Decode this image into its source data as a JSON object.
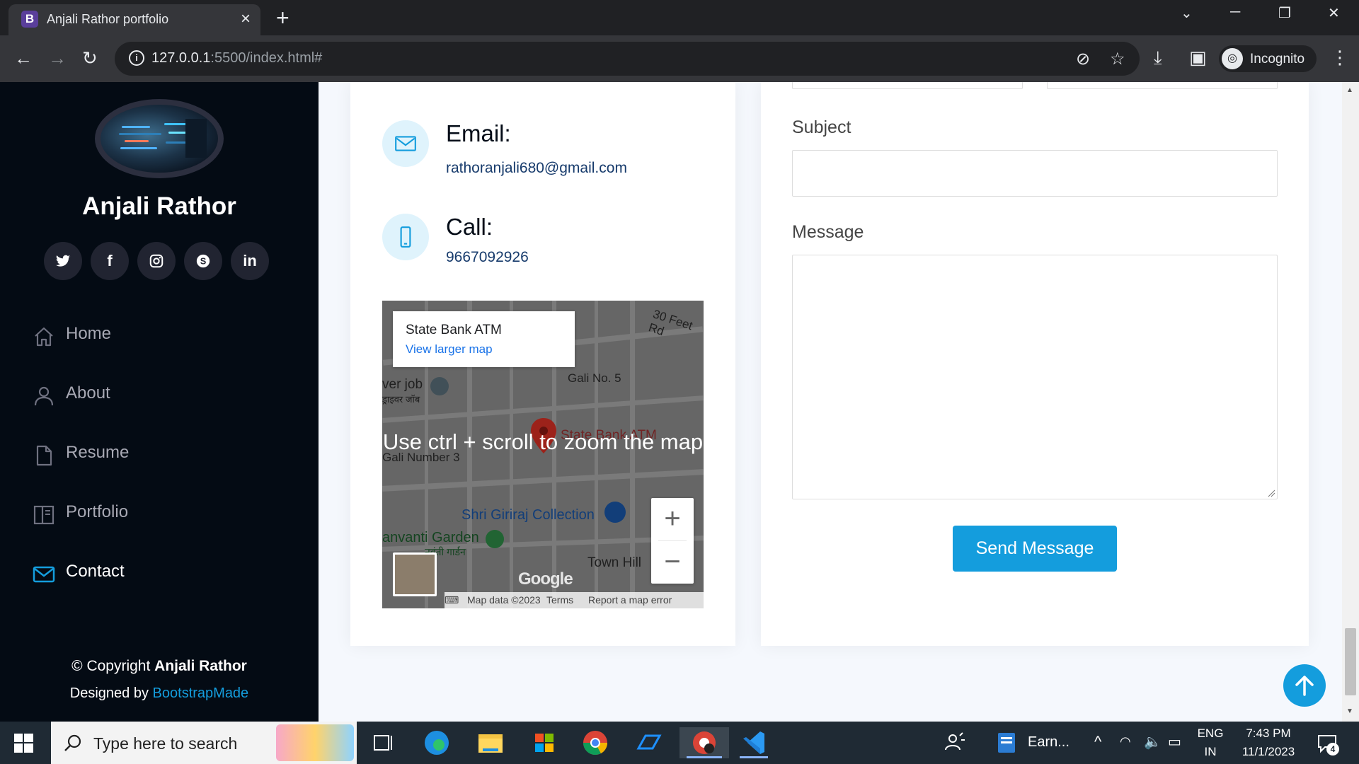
{
  "browser": {
    "tab_favicon": "B",
    "tab_title": "Anjali Rathor portfolio",
    "url_host": "127.0.0.1",
    "url_rest": ":5500/index.html#",
    "incognito_label": "Incognito"
  },
  "sidebar": {
    "name": "Anjali Rathor",
    "social": [
      "twitter-icon",
      "facebook-icon",
      "instagram-icon",
      "skype-icon",
      "linkedin-icon"
    ],
    "nav": [
      {
        "label": "Home",
        "icon": "home-icon",
        "active": false
      },
      {
        "label": "About",
        "icon": "person-icon",
        "active": false
      },
      {
        "label": "Resume",
        "icon": "file-icon",
        "active": false
      },
      {
        "label": "Portfolio",
        "icon": "book-icon",
        "active": false
      },
      {
        "label": "Contact",
        "icon": "envelope-icon",
        "active": true
      }
    ],
    "copyright_prefix": "© Copyright ",
    "copyright_name": "Anjali Rathor",
    "designed_by": "Designed by ",
    "designed_link": "BootstrapMade"
  },
  "contact_info": {
    "email_title": "Email:",
    "email_value": "rathoranjali680@gmail.com",
    "call_title": "Call:",
    "call_value": "9667092926"
  },
  "map": {
    "popup_title": "State Bank ATM",
    "popup_link": "View larger map",
    "scroll_message": "Use ctrl + scroll to zoom the map",
    "labels": {
      "road_30ft": "30 Feet Rd",
      "gali5": "Gali No. 5",
      "driver_job": "ver job",
      "driver_job_hi": "ड्राइवर जॉब",
      "gali3": "Gali Number 3",
      "state_bank": "State Bank ATM",
      "shri_giriraj": "Shri Giriraj Collection",
      "garden": "anvanti Garden",
      "garden_hi": "नवंती गार्डन",
      "town_hill": "Town Hill"
    },
    "zoom_in": "+",
    "zoom_out": "−",
    "google": "Google",
    "footer": [
      "Map data ©2023",
      "Terms",
      "Report a map error"
    ]
  },
  "form": {
    "subject_label": "Subject",
    "message_label": "Message",
    "send_label": "Send Message"
  },
  "taskbar": {
    "search_placeholder": "Type here to search",
    "pinned_app_label": "Earn...",
    "lang_line1": "ENG",
    "lang_line2": "IN",
    "time": "7:43 PM",
    "date": "11/1/2023",
    "notification_count": "4"
  },
  "colors": {
    "accent": "#149ddd",
    "sidebar_bg": "#040b14",
    "page_bg": "#f5f8fd"
  }
}
